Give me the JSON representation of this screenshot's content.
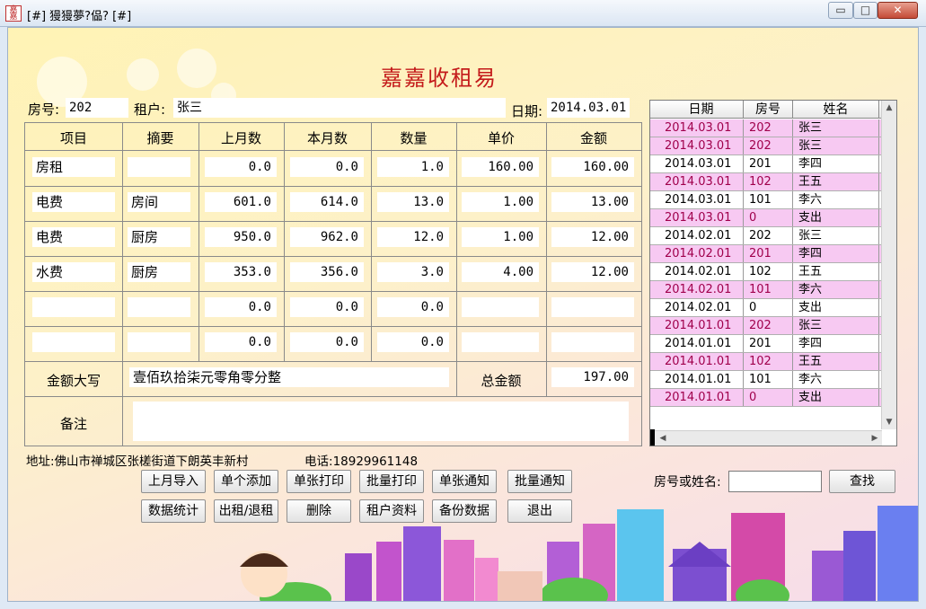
{
  "window": {
    "title": "[#] 獌獌夢?偘? [#]",
    "app_icon_text": "嘉嘉",
    "min_glyph": "▭",
    "max_glyph": "□",
    "close_glyph": "✕"
  },
  "app_title": "嘉嘉收租易",
  "header": {
    "room_label": "房号:",
    "room_value": "202",
    "tenant_label": "租户:",
    "tenant_value": "张三",
    "date_label": "日期:",
    "date_value": "2014.03.01"
  },
  "table": {
    "columns": [
      "项目",
      "摘要",
      "上月数",
      "本月数",
      "数量",
      "单价",
      "金额"
    ],
    "rows": [
      {
        "item": "房租",
        "summary": "",
        "prev": "0.0",
        "curr": "0.0",
        "qty": "1.0",
        "price": "160.00",
        "amount": "160.00"
      },
      {
        "item": "电费",
        "summary": "房间",
        "prev": "601.0",
        "curr": "614.0",
        "qty": "13.0",
        "price": "1.00",
        "amount": "13.00"
      },
      {
        "item": "电费",
        "summary": "厨房",
        "prev": "950.0",
        "curr": "962.0",
        "qty": "12.0",
        "price": "1.00",
        "amount": "12.00"
      },
      {
        "item": "水费",
        "summary": "厨房",
        "prev": "353.0",
        "curr": "356.0",
        "qty": "3.0",
        "price": "4.00",
        "amount": "12.00"
      },
      {
        "item": "",
        "summary": "",
        "prev": "0.0",
        "curr": "0.0",
        "qty": "0.0",
        "price": "",
        "amount": ""
      },
      {
        "item": "",
        "summary": "",
        "prev": "0.0",
        "curr": "0.0",
        "qty": "0.0",
        "price": "",
        "amount": ""
      }
    ],
    "amount_words_label": "金额大写",
    "amount_words_value": "壹佰玖拾柒元零角零分整",
    "total_label": "总金额",
    "total_value": "197.00",
    "notes_label": "备注",
    "notes_value": ""
  },
  "footer_info": {
    "address_label": "地址:",
    "address_value": "佛山市禅城区张槎街道下朗英丰新村",
    "phone_label": "电话:",
    "phone_value": "18929961148"
  },
  "buttons_row1": [
    "上月导入",
    "单个添加",
    "单张打印",
    "批量打印",
    "单张通知",
    "批量通知"
  ],
  "buttons_row2": [
    "数据统计",
    "出租/退租",
    "删除",
    "租户资料",
    "备份数据",
    "退出"
  ],
  "search": {
    "label": "房号或姓名:",
    "value": "",
    "button": "查找"
  },
  "records": {
    "columns": [
      "日期",
      "房号",
      "姓名"
    ],
    "rows": [
      {
        "date": "2014.03.01",
        "room": "202",
        "name": "张三",
        "highlight": true
      },
      {
        "date": "2014.03.01",
        "room": "202",
        "name": "张三",
        "highlight": true
      },
      {
        "date": "2014.03.01",
        "room": "201",
        "name": "李四",
        "highlight": false
      },
      {
        "date": "2014.03.01",
        "room": "102",
        "name": "王五",
        "highlight": true
      },
      {
        "date": "2014.03.01",
        "room": "101",
        "name": "李六",
        "highlight": false
      },
      {
        "date": "2014.03.01",
        "room": "0",
        "name": "支出",
        "highlight": true
      },
      {
        "date": "2014.02.01",
        "room": "202",
        "name": "张三",
        "highlight": false
      },
      {
        "date": "2014.02.01",
        "room": "201",
        "name": "李四",
        "highlight": true
      },
      {
        "date": "2014.02.01",
        "room": "102",
        "name": "王五",
        "highlight": false
      },
      {
        "date": "2014.02.01",
        "room": "101",
        "name": "李六",
        "highlight": true
      },
      {
        "date": "2014.02.01",
        "room": "0",
        "name": "支出",
        "highlight": false
      },
      {
        "date": "2014.01.01",
        "room": "202",
        "name": "张三",
        "highlight": true
      },
      {
        "date": "2014.01.01",
        "room": "201",
        "name": "李四",
        "highlight": false
      },
      {
        "date": "2014.01.01",
        "room": "102",
        "name": "王五",
        "highlight": true
      },
      {
        "date": "2014.01.01",
        "room": "101",
        "name": "李六",
        "highlight": false
      },
      {
        "date": "2014.01.01",
        "room": "0",
        "name": "支出",
        "highlight": true
      }
    ]
  },
  "colors": {
    "title_red": "#c41b1b",
    "row_pink": "#f7c9f2"
  }
}
